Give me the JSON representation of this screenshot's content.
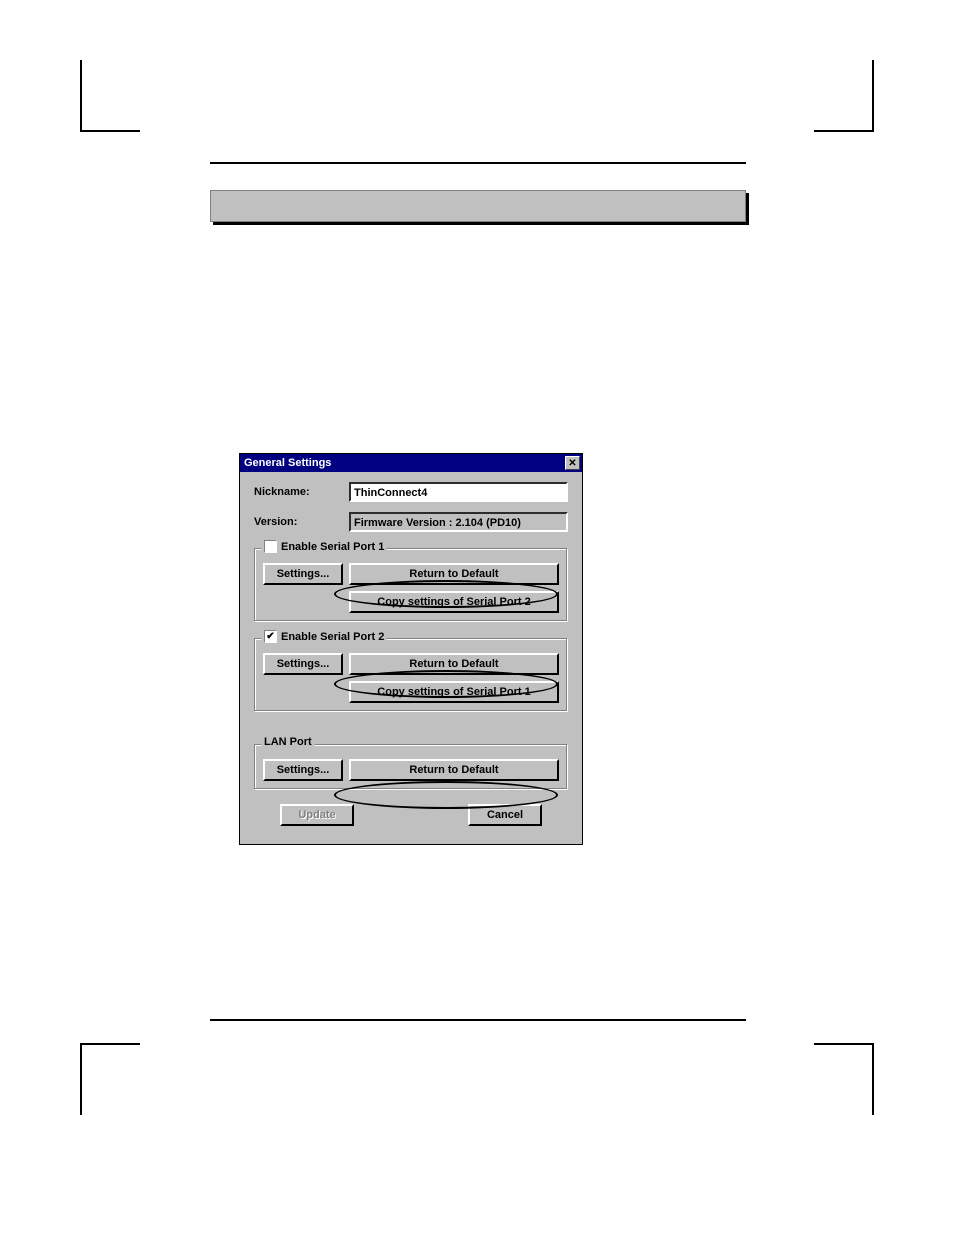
{
  "dialog": {
    "title": "General Settings",
    "nickname_label": "Nickname:",
    "nickname_value": "ThinConnect4",
    "version_label": "Version:",
    "version_value": "Firmware Version : 2.104  (PD10)",
    "serial1": {
      "legend": "Enable Serial Port 1",
      "checked": false,
      "settings_btn": "Settings...",
      "return_btn": "Return to Default",
      "copy_btn": "Copy settings of Serial Port 2"
    },
    "serial2": {
      "legend": "Enable Serial Port 2",
      "checked": true,
      "settings_btn": "Settings...",
      "return_btn": "Return to Default",
      "copy_btn": "Copy settings of Serial Port 1"
    },
    "lan": {
      "legend": "LAN Port",
      "settings_btn": "Settings...",
      "return_btn": "Return to Default"
    },
    "update_btn": "Update",
    "cancel_btn": "Cancel"
  }
}
